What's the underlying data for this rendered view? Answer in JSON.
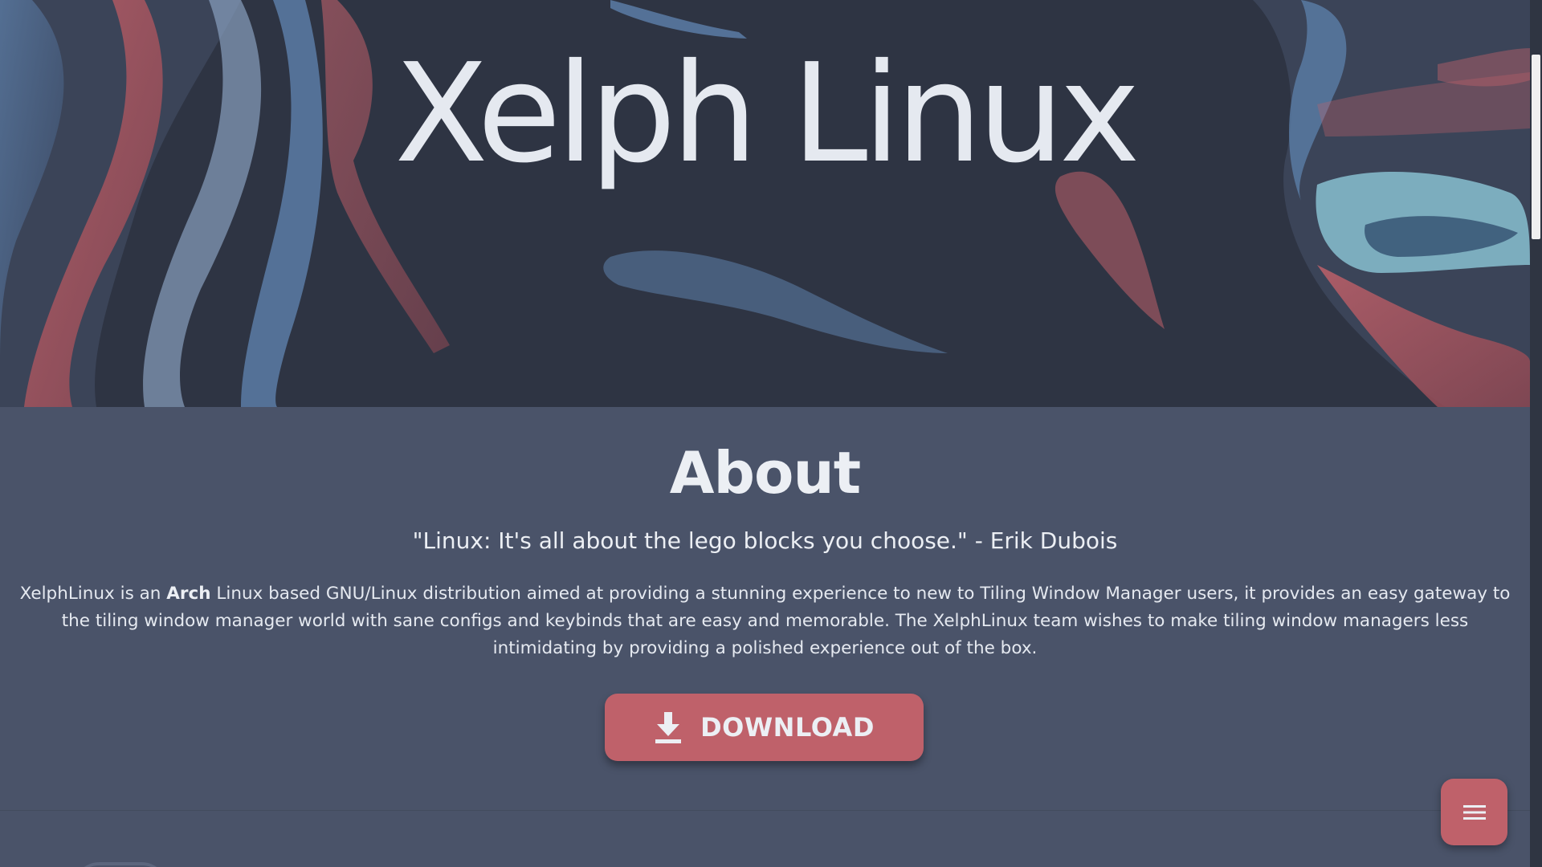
{
  "hero": {
    "title": "Xelph Linux"
  },
  "about": {
    "heading": "About",
    "quote": "\"Linux: It's all about the lego blocks you choose.\" - Erik Dubois",
    "paragraph_before": "XelphLinux is an ",
    "paragraph_bold": "Arch",
    "paragraph_after": " Linux based GNU/Linux distribution aimed at providing a stunning experience to new to Tiling Window Manager users, it provides an easy gateway to the tiling window manager world with sane configs and keybinds that are easy and memorable. The XelphLinux team wishes to make tiling window managers less intimidating by providing a polished experience out of the box.",
    "download_label": "DOWNLOAD"
  },
  "icons": {
    "download": "download-icon",
    "menu": "hamburger-menu-icon"
  },
  "colors": {
    "hero_background": "#2e3443",
    "section_background": "#4a5369",
    "accent": "#bf616a",
    "text": "#eceff4",
    "art_blue": "#5e81ac",
    "art_cyan": "#88c0d0",
    "art_red": "#bf616a"
  }
}
